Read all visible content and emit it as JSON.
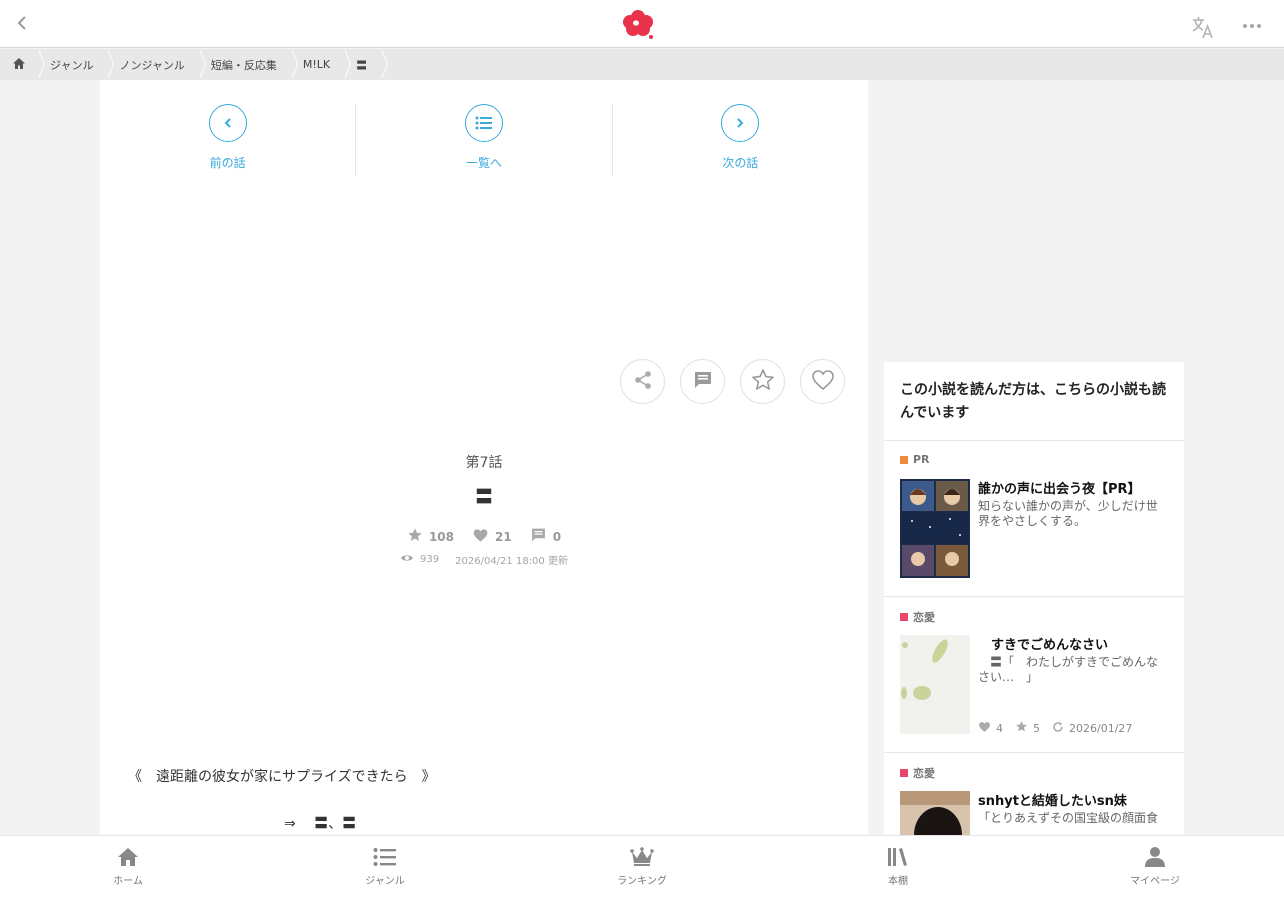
{
  "header": {
    "back_icon": "chevron-left-icon",
    "logo": "flower-logo",
    "translate_icon": "translate-icon",
    "more_icon": "more-dots-icon"
  },
  "breadcrumb": {
    "items": [
      "ジャンル",
      "ノンジャンル",
      "短編・反応集",
      "M!LK",
      "〓"
    ]
  },
  "episode_nav": {
    "prev": "前の話",
    "list": "一覧へ",
    "next": "次の話"
  },
  "episode": {
    "number": "第7話",
    "title": "〓",
    "stars": "108",
    "likes": "21",
    "comments": "0",
    "views": "939",
    "updated": "2026/04/21 18:00 更新"
  },
  "body": {
    "line1": "《　遠距離の彼女が家にサプライズできたら　》",
    "line2": "⇒　 〓、〓"
  },
  "sidebar": {
    "heading": "この小説を読んだ方は、こちらの小説も読んでいます",
    "cards": [
      {
        "tag": "PR",
        "tag_color": "#f08a3c",
        "title": "誰かの声に出会う夜【PR】",
        "desc": "知らない誰かの声が、少しだけ世界をやさしくする。"
      },
      {
        "tag": "恋愛",
        "tag_color": "#e8466a",
        "title": "　すきでごめんなさい",
        "desc": "　〓「　わたしがすきでごめんなさい…　」",
        "likes": "4",
        "stars": "5",
        "date": "2026/01/27"
      },
      {
        "tag": "恋愛",
        "tag_color": "#e8466a",
        "title": "snhytと結婚したいsn妹",
        "desc": "「とりあえずその国宝級の顔面食"
      }
    ]
  },
  "tabbar": {
    "home": "ホーム",
    "genre": "ジャンル",
    "ranking": "ランキング",
    "shelf": "本棚",
    "mypage": "マイページ"
  },
  "colors": {
    "accent": "#3aa9dc",
    "brand": "#e8334a"
  }
}
